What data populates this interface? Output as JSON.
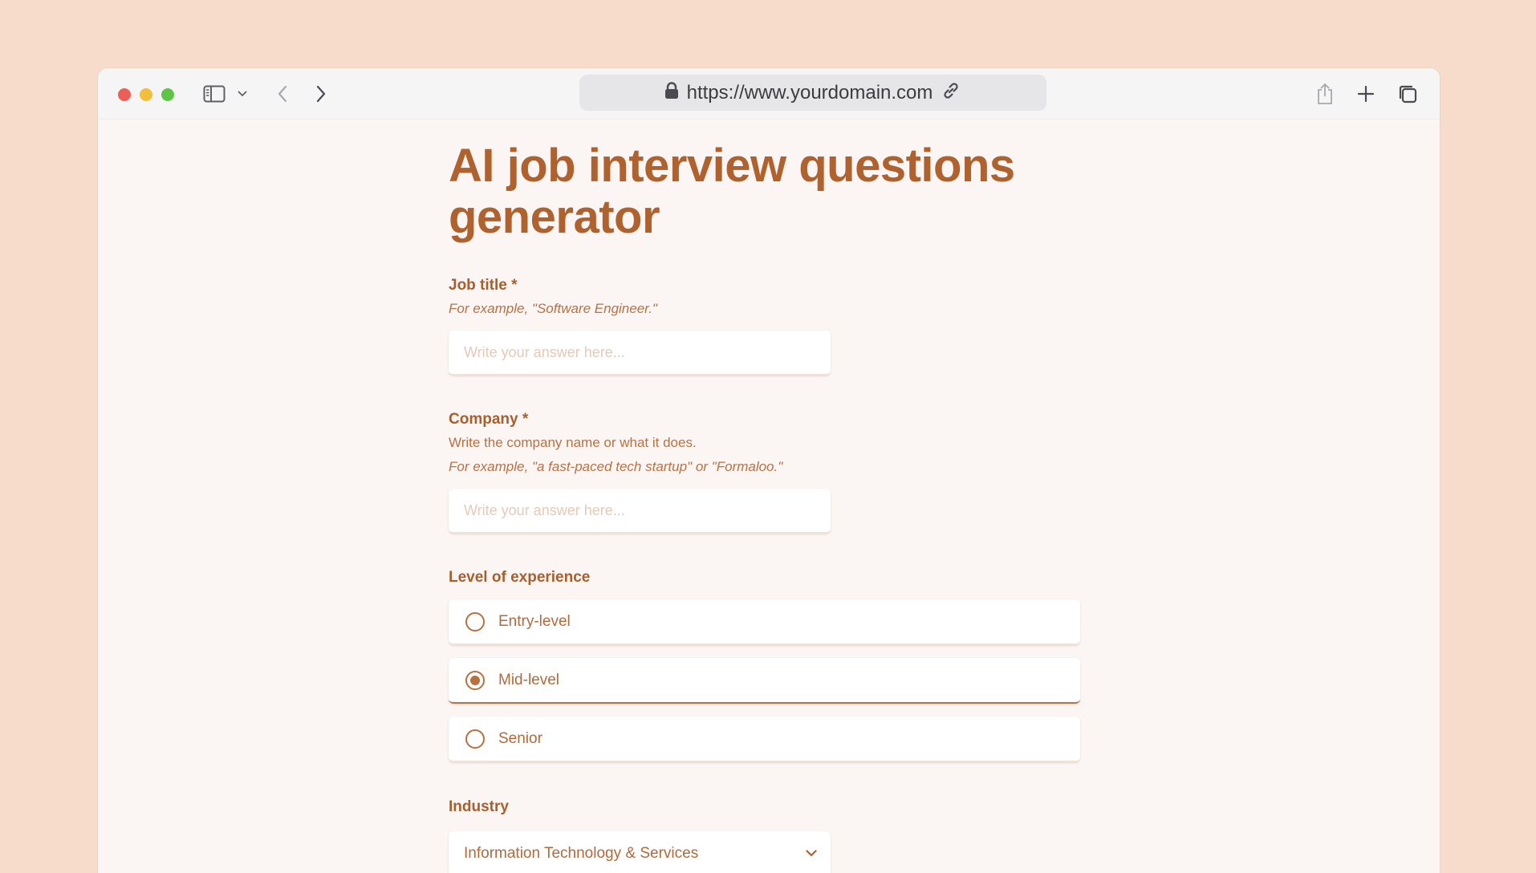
{
  "browser": {
    "url": "https://www.yourdomain.com"
  },
  "form": {
    "title": "AI job interview questions generator",
    "job_title": {
      "label": "Job title *",
      "hint": "For example, \"Software Engineer.\"",
      "placeholder": "Write your answer here..."
    },
    "company": {
      "label": "Company *",
      "description": "Write the company name or what it does.",
      "hint": "For example, \"a fast-paced tech startup\" or \"Formaloo.\"",
      "placeholder": "Write your answer here..."
    },
    "experience": {
      "label": "Level of experience",
      "options": [
        {
          "label": "Entry-level",
          "selected": false
        },
        {
          "label": "Mid-level",
          "selected": true
        },
        {
          "label": "Senior",
          "selected": false
        }
      ]
    },
    "industry": {
      "label": "Industry",
      "selected_value": "Information Technology & Services"
    }
  },
  "colors": {
    "accent": "#b0622e",
    "background": "#f8dccb"
  }
}
